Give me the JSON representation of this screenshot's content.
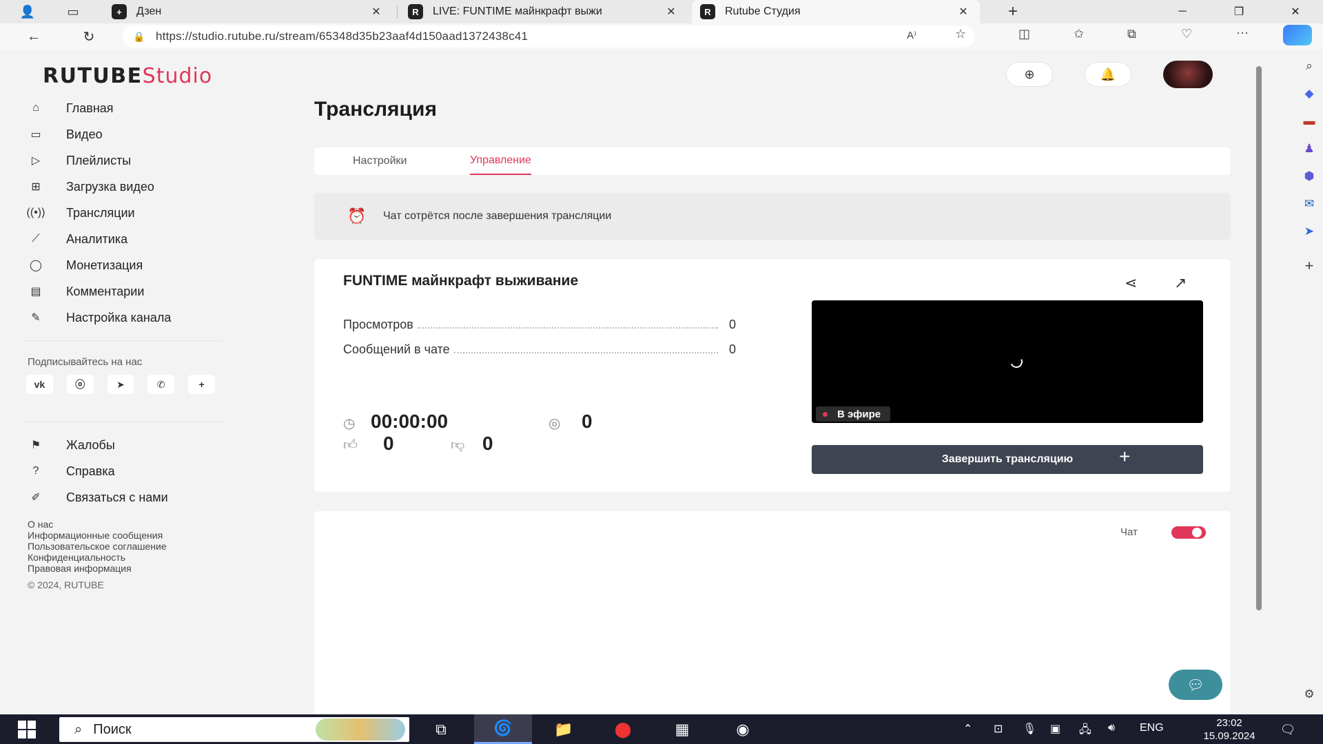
{
  "browser": {
    "tabs": [
      {
        "title": "Дзен",
        "favicon": "zen-plus-icon"
      },
      {
        "title": "LIVE: FUNTIME майнкрафт выжи",
        "favicon": "rutube-r-icon"
      },
      {
        "title": "Rutube Студия",
        "favicon": "rutube-r-icon"
      }
    ],
    "address": "https://studio.rutube.ru/stream/65348d35b23aaf4d150aad1372438c41"
  },
  "header": {
    "logo_main": "RUTUBE",
    "logo_sub": "Studio"
  },
  "sidebar": {
    "items": [
      {
        "label": "Главная",
        "icon": "home-icon"
      },
      {
        "label": "Видео",
        "icon": "video-icon"
      },
      {
        "label": "Плейлисты",
        "icon": "playlist-icon"
      },
      {
        "label": "Загрузка видео",
        "icon": "upload-video-icon"
      },
      {
        "label": "Трансляции",
        "icon": "broadcast-icon"
      },
      {
        "label": "Аналитика",
        "icon": "analytics-icon"
      },
      {
        "label": "Монетизация",
        "icon": "monetization-icon"
      },
      {
        "label": "Комментарии",
        "icon": "comments-icon"
      },
      {
        "label": "Настройка канала",
        "icon": "channel-settings-icon"
      }
    ],
    "follow_label": "Подписывайтесь на нас",
    "socials": [
      "vk",
      "ok",
      "telegram",
      "viber",
      "more"
    ],
    "bottom_items": [
      {
        "label": "Жалобы",
        "icon": "flag-icon"
      },
      {
        "label": "Справка",
        "icon": "help-icon"
      },
      {
        "label": "Связаться с нами",
        "icon": "contact-icon"
      }
    ],
    "footer_links": [
      "О нас",
      "Информационные сообщения",
      "Пользовательское соглашение",
      "Конфиденциальность",
      "Правовая информация"
    ],
    "copyright": "© 2024, RUTUBE"
  },
  "main": {
    "title": "Трансляция",
    "tabs": [
      {
        "label": "Настройки",
        "active": false
      },
      {
        "label": "Управление",
        "active": true
      }
    ],
    "notice": "Чат сотрётся после завершения трансляции",
    "stream": {
      "title": "FUNTIME майнкрафт выживание",
      "stats": [
        {
          "label": "Просмотров",
          "value": "0"
        },
        {
          "label": "Сообщений в чате",
          "value": "0"
        }
      ],
      "duration": "00:00:00",
      "viewers": "0",
      "likes": "0",
      "dislikes": "0",
      "live_badge": "В эфире",
      "end_button": "Завершить трансляцию"
    },
    "chat": {
      "label": "Чат",
      "enabled": true
    }
  },
  "taskbar": {
    "search_placeholder": "Поиск",
    "lang": "ENG",
    "time": "23:02",
    "date": "15.09.2024"
  },
  "colors": {
    "accent": "#e1365a",
    "button_dark": "#3f4452",
    "taskbar": "#1b1d2d"
  }
}
